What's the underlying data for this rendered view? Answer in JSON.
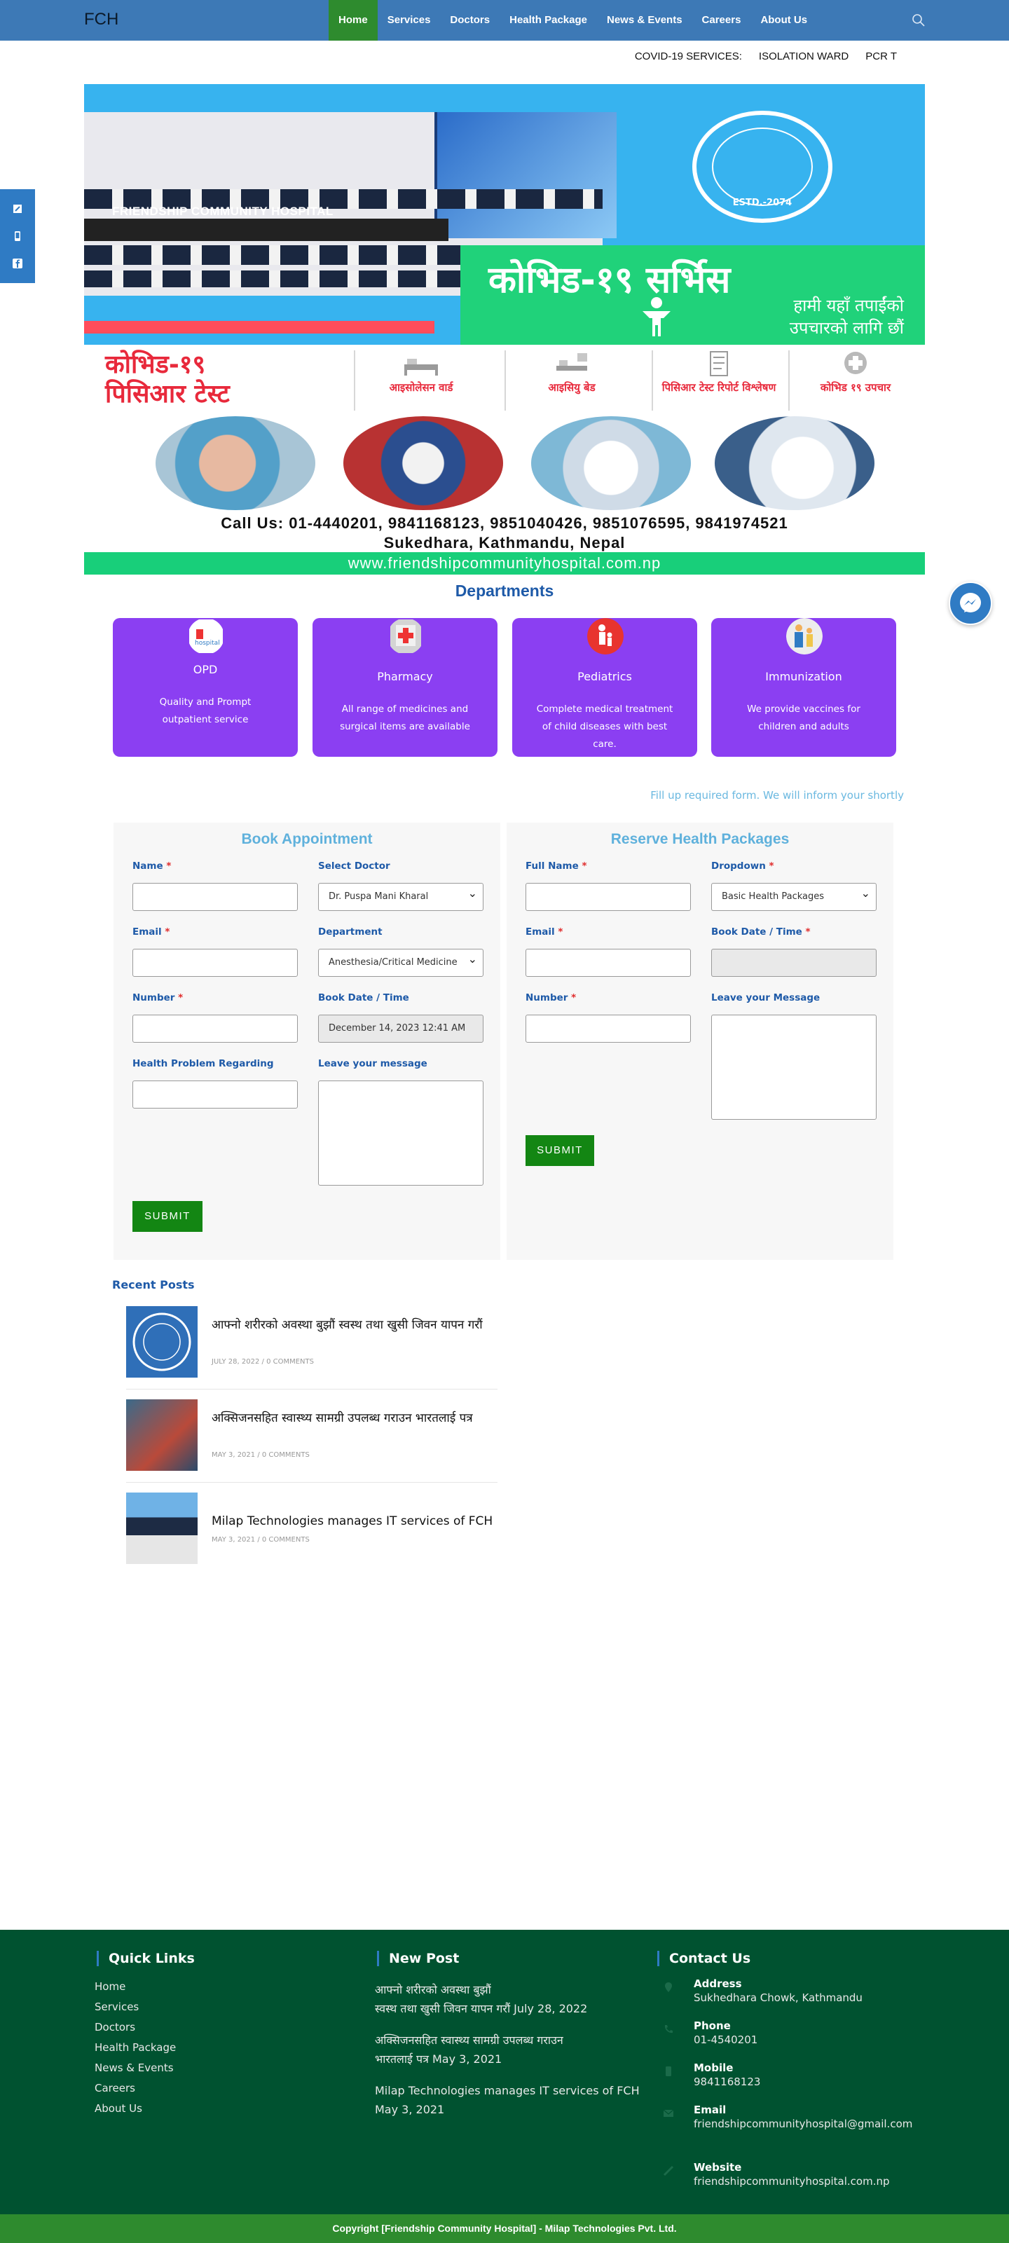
{
  "header": {
    "brand": "FCH",
    "nav": [
      "Home",
      "Services",
      "Doctors",
      "Health Package",
      "News & Events",
      "Careers",
      "About Us"
    ],
    "active_nav": "Home"
  },
  "covid_links": [
    "COVID-19 SERVICES:",
    "ISOLATION WARD",
    "PCR T"
  ],
  "banner": {
    "hospital_name": "FRIENDSHIP COMMUNITY HOSPITAL",
    "title": "कोभिड-१९ सर्भिस",
    "subtitle_line1": "हामी यहाँ तपाईंको",
    "subtitle_line2": "उपचारको लागि छौं",
    "seal_text": "ESTD.-2074"
  },
  "pcr_strip": {
    "title_line1": "कोभिड-१९",
    "title_line2": "पिसिआर टेस्ट",
    "columns": [
      "आइसोलेसन वार्ड",
      "आइसियु बेड",
      "पिसिआर टेस्ट रिपोर्ट विश्लेषण",
      "कोभिड १९ उपचार"
    ],
    "call": "Call Us: 01-4440201, 9841168123, 9851040426, 9851076595, 9841974521",
    "address": "Sukedhara, Kathmandu, Nepal",
    "website": "www.friendshipcommunityhospital.com.np"
  },
  "departments": {
    "title": "Departments",
    "cards": [
      {
        "name": "OPD",
        "desc": "Quality and Prompt outpatient service"
      },
      {
        "name": "Pharmacy",
        "desc": "All range of medicines and surgical items are available"
      },
      {
        "name": "Pediatrics",
        "desc": "Complete medical treatment of child diseases with best care."
      },
      {
        "name": "Immunization",
        "desc": "We provide vaccines for children and adults"
      }
    ]
  },
  "fill_note": "Fill up required form. We will inform your shortly",
  "appointment": {
    "title": "Book Appointment",
    "name_label": "Name",
    "doctor_label": "Select Doctor",
    "doctor_value": "Dr. Puspa Mani Kharal",
    "email_label": "Email",
    "department_label": "Department",
    "department_value": "Anesthesia/Critical Medicine",
    "number_label": "Number",
    "date_label": "Book Date / Time",
    "date_value": "December 14, 2023 12:41 AM",
    "problem_label": "Health Problem Regarding",
    "message_label": "Leave your message",
    "submit": "SUBMIT"
  },
  "reserve": {
    "title": "Reserve Health Packages",
    "name_label": "Full Name",
    "dropdown_label": "Dropdown",
    "dropdown_value": "Basic Health Packages",
    "email_label": "Email",
    "date_label": "Book Date / Time",
    "number_label": "Number",
    "message_label": "Leave your Message",
    "submit": "SUBMIT"
  },
  "recent_posts": {
    "title": "Recent Posts",
    "items": [
      {
        "title": "आफ्नो शरीरको अवस्था बुझौं स्वस्थ तथा खुसी जिवन यापन गरौं",
        "date": "JULY 28, 2022",
        "comments": "0 COMMENTS"
      },
      {
        "title": "अक्सिजनसहित स्वास्थ्य सामग्री उपलब्ध गराउन भारतलाई पत्र",
        "date": "MAY 3, 2021",
        "comments": "0 COMMENTS"
      },
      {
        "title": "Milap Technologies manages IT services of FCH",
        "date": "MAY 3, 2021",
        "comments": "0 COMMENTS"
      }
    ]
  },
  "footer": {
    "quick_links_title": "Quick Links",
    "quick_links": [
      "Home",
      "Services",
      "Doctors",
      "Health Package",
      "News & Events",
      "Careers",
      "About Us"
    ],
    "new_post_title": "New Post",
    "new_posts": [
      {
        "line1": "आफ्नो शरीरको अवस्था बुझौं",
        "line2": "स्वस्थ तथा खुसी जिवन यापन गरौं July 28, 2022"
      },
      {
        "line1": "अक्सिजनसहित स्वास्थ्य सामग्री उपलब्ध गराउन",
        "line2": "भारतलाई पत्र May 3, 2021"
      },
      {
        "line1": "Milap Technologies manages IT services of FCH",
        "line2": "May 3, 2021"
      }
    ],
    "contact_title": "Contact Us",
    "contact": [
      {
        "key": "Address",
        "value": "Sukhedhara Chowk, Kathmandu"
      },
      {
        "key": "Phone",
        "value": "01-4540201"
      },
      {
        "key": "Mobile",
        "value": "9841168123"
      },
      {
        "key": "Email",
        "value": "friendshipcommunityhospital@gmail.com"
      },
      {
        "key": "Website",
        "value": "friendshipcommunityhospital.com.np"
      }
    ],
    "copyright": "Copyright [Friendship Community Hospital] - Milap Technologies Pvt. Ltd."
  },
  "colors": {
    "header_blue": "#3d79b6",
    "active_green": "#2e8b2e",
    "dept_purple": "#8b3ff2",
    "footer_green": "#005230",
    "submit_green": "#138613",
    "title_blue": "#1e5aa8"
  },
  "icons": [
    "search-icon",
    "square-icon",
    "mobile-icon",
    "facebook-icon",
    "messenger-icon",
    "location-icon",
    "phone-icon",
    "mobile-phone-icon",
    "envelope-icon",
    "globe-icon"
  ]
}
